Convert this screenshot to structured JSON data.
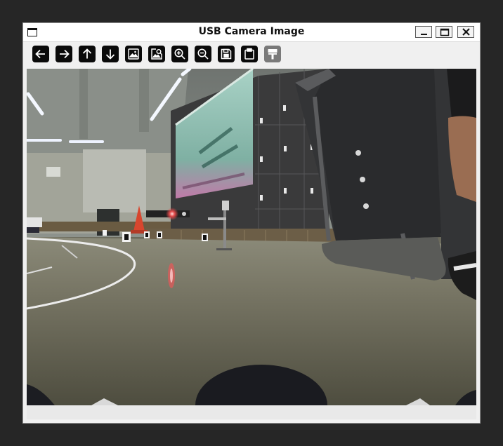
{
  "window": {
    "title": "USB Camera Image"
  },
  "titlebar_buttons": [
    {
      "name": "minimize-button",
      "icon": "minimize-icon"
    },
    {
      "name": "maximize-button",
      "icon": "maximize-icon"
    },
    {
      "name": "close-button",
      "icon": "close-icon"
    }
  ],
  "toolbar": {
    "buttons": [
      {
        "name": "back-button",
        "icon": "arrow-left-icon",
        "enabled": true
      },
      {
        "name": "forward-button",
        "icon": "arrow-right-icon",
        "enabled": true
      },
      {
        "name": "up-button",
        "icon": "arrow-up-icon",
        "enabled": true
      },
      {
        "name": "down-button",
        "icon": "arrow-down-icon",
        "enabled": true
      },
      {
        "name": "image-button",
        "icon": "image-icon",
        "enabled": true
      },
      {
        "name": "image-search-button",
        "icon": "image-search-icon",
        "enabled": true
      },
      {
        "name": "zoom-in-button",
        "icon": "zoom-in-icon",
        "enabled": true
      },
      {
        "name": "zoom-out-button",
        "icon": "zoom-out-icon",
        "enabled": true
      },
      {
        "name": "save-button",
        "icon": "save-icon",
        "enabled": true
      },
      {
        "name": "clipboard-button",
        "icon": "clipboard-icon",
        "enabled": true
      },
      {
        "name": "paint-button",
        "icon": "paint-roller-icon",
        "enabled": false
      }
    ]
  },
  "viewport": {
    "content": "camera-feed",
    "poster_text": "",
    "status_text": ""
  }
}
